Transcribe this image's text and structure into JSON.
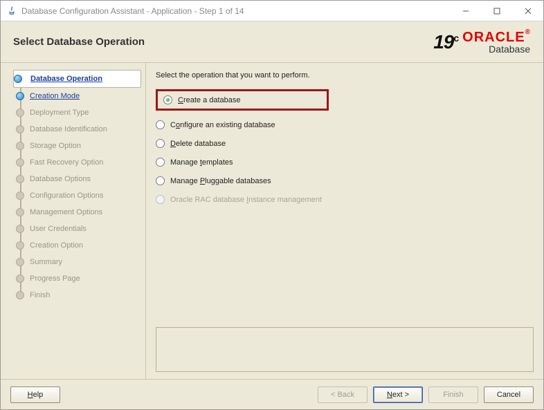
{
  "window": {
    "title": "Database Configuration Assistant - Application - Step 1 of 14"
  },
  "header": {
    "title": "Select Database Operation",
    "version": "19",
    "version_suffix": "c",
    "brand": "ORACLE",
    "brand_sub": "Database"
  },
  "sidebar": {
    "steps": [
      {
        "label": "Database Operation",
        "state": "active"
      },
      {
        "label": "Creation Mode",
        "state": "link"
      },
      {
        "label": "Deployment Type",
        "state": "disabled"
      },
      {
        "label": "Database Identification",
        "state": "disabled"
      },
      {
        "label": "Storage Option",
        "state": "disabled"
      },
      {
        "label": "Fast Recovery Option",
        "state": "disabled"
      },
      {
        "label": "Database Options",
        "state": "disabled"
      },
      {
        "label": "Configuration Options",
        "state": "disabled"
      },
      {
        "label": "Management Options",
        "state": "disabled"
      },
      {
        "label": "User Credentials",
        "state": "disabled"
      },
      {
        "label": "Creation Option",
        "state": "disabled"
      },
      {
        "label": "Summary",
        "state": "disabled"
      },
      {
        "label": "Progress Page",
        "state": "disabled"
      },
      {
        "label": "Finish",
        "state": "disabled"
      }
    ]
  },
  "main": {
    "instruction": "Select the operation that you want to perform.",
    "options": [
      {
        "pre": "",
        "ul": "C",
        "post": "reate a database",
        "selected": true,
        "enabled": true,
        "highlight": true
      },
      {
        "pre": "C",
        "ul": "o",
        "post": "nfigure an existing database",
        "selected": false,
        "enabled": true
      },
      {
        "pre": "",
        "ul": "D",
        "post": "elete database",
        "selected": false,
        "enabled": true
      },
      {
        "pre": "Manage ",
        "ul": "t",
        "post": "emplates",
        "selected": false,
        "enabled": true
      },
      {
        "pre": "Manage ",
        "ul": "P",
        "post": "luggable databases",
        "selected": false,
        "enabled": true
      },
      {
        "pre": "Oracle RAC database ",
        "ul": "I",
        "post": "nstance management",
        "selected": false,
        "enabled": false
      }
    ]
  },
  "footer": {
    "help": "Help",
    "back": "< Back",
    "next": "Next >",
    "finish": "Finish",
    "cancel": "Cancel"
  }
}
